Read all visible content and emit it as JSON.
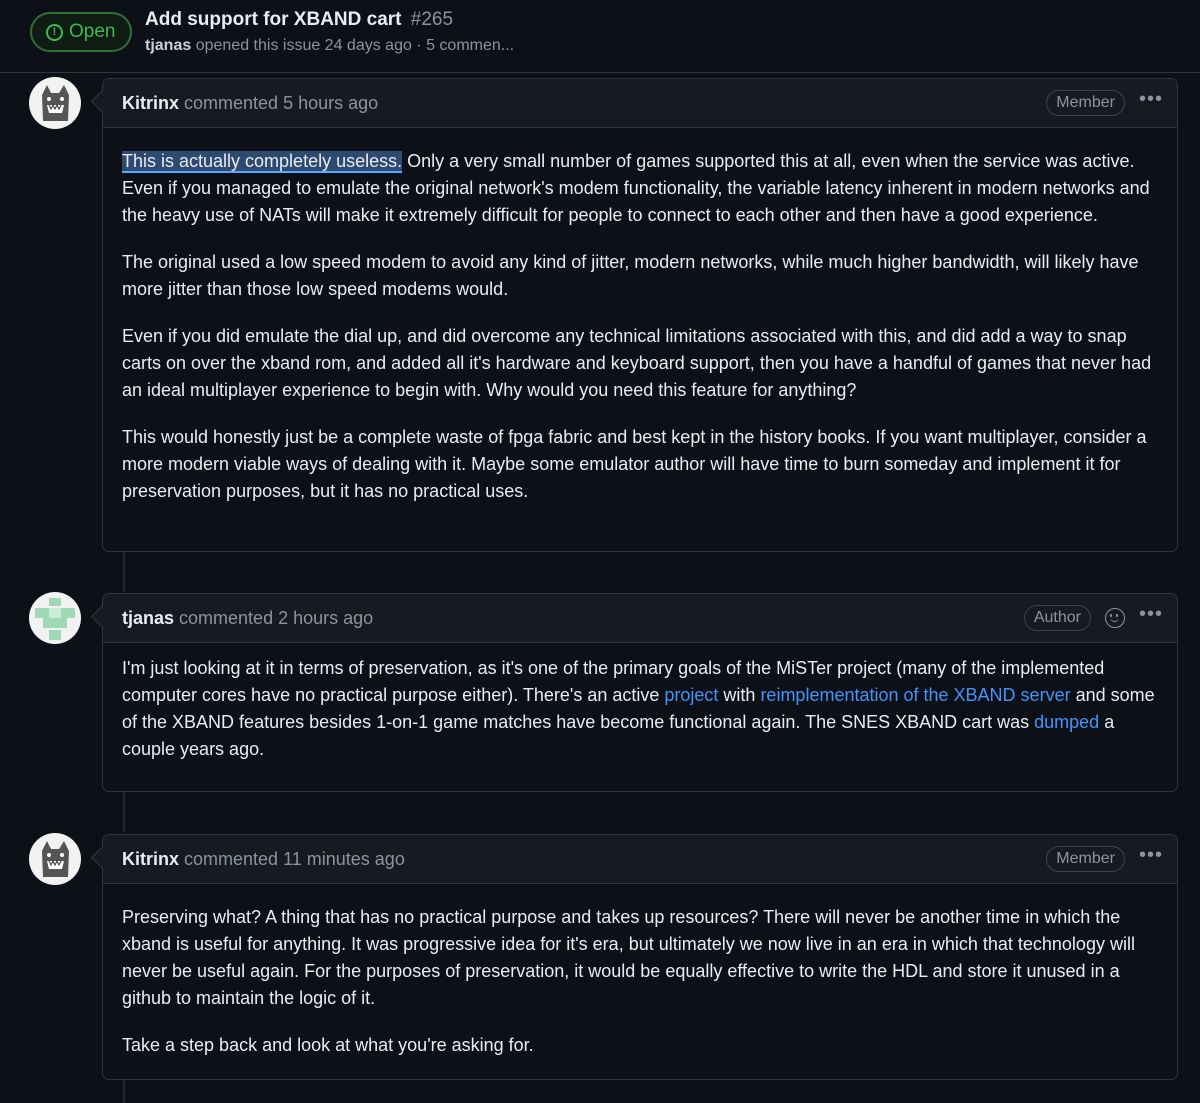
{
  "issue": {
    "state": "Open",
    "title": "Add support for XBAND cart",
    "number": "#265",
    "author": "tjanas",
    "meta": "opened this issue 24 days ago · 5 commen..."
  },
  "comments": [
    {
      "author": "Kitrinx",
      "action": "commented",
      "time": "5 hours ago",
      "role": "Member",
      "paragraphs": [
        {
          "highlight": "This is actually completely useless.",
          "text": " Only a very small number of games supported this at all, even when the service was active. Even if you managed to emulate the original network's modem functionality, the variable latency inherent in modern networks and the heavy use of NATs will make it extremely difficult for people to connect to each other and then have a good experience."
        },
        "The original used a low speed modem to avoid any kind of jitter, modern networks, while much higher bandwidth, will likely have more jitter than those low speed modems would.",
        "Even if you did emulate the dial up, and did overcome any technical limitations associated with this, and did add a way to snap carts on over the xband rom, and added all it's hardware and keyboard support, then you have a handful of games that never had an ideal multiplayer experience to begin with. Why would you need this feature for anything?",
        "This would honestly just be a complete waste of fpga fabric and best kept in the history books. If you want multiplayer, consider a more modern viable ways of dealing with it. Maybe some emulator author will have time to burn someday and implement it for preservation purposes, but it has no practical uses."
      ]
    },
    {
      "author": "tjanas",
      "action": "commented",
      "time": "2 hours ago",
      "role": "Author",
      "paragraph": {
        "t1": "I'm just looking at it in terms of preservation, as it's one of the primary goals of the MiSTer project (many of the implemented computer cores have no practical purpose either). There's an active ",
        "link1": "project",
        "t2": " with ",
        "link2": "reimplementation of the XBAND server",
        "t3": " and some of the XBAND features besides 1-on-1 game matches have become functional again. The SNES XBAND cart was ",
        "link3": "dumped",
        "t4": " a couple years ago."
      }
    },
    {
      "author": "Kitrinx",
      "action": "commented",
      "time": "11 minutes ago",
      "role": "Member",
      "paragraphs": [
        "Preserving what? A thing that has no practical purpose and takes up resources? There will never be another time in which the xband is useful for anything. It was progressive idea for it's era, but ultimately we now live in an era in which that technology will never be useful again. For the purposes of preservation, it would be equally effective to write the HDL and store it unused in a github to maintain the logic of it.",
        "Take a step back and look at what you're asking for."
      ]
    }
  ],
  "icons": {
    "state": "issue-opened-icon",
    "kebab": "kebab-horizontal-icon",
    "reaction": "smiley-icon"
  },
  "colors": {
    "background": "#0d1117",
    "open_green": "#3fb950",
    "link": "#4493f8",
    "selection": "#2f4a70"
  }
}
